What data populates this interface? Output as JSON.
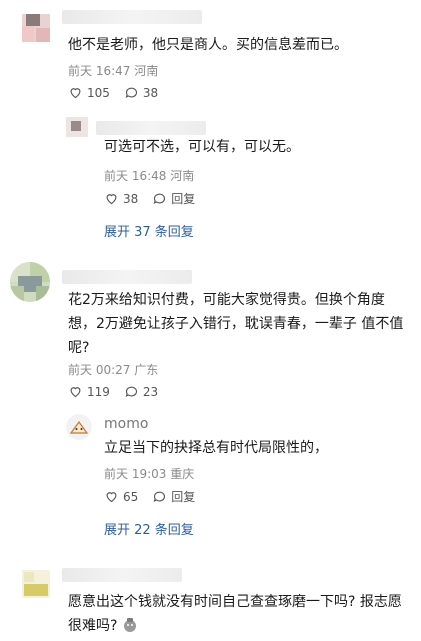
{
  "comments": [
    {
      "text": "他不是老师，他只是商人。买的信息差而已。",
      "time": "前天 16:47",
      "location": "河南",
      "likes": "105",
      "replies_count": "38",
      "reply": {
        "text": "可选可不选，可以有，可以无。",
        "time": "前天 16:48",
        "location": "河南",
        "likes": "38",
        "reply_label": "回复"
      },
      "expand_label": "展开 37 条回复"
    },
    {
      "text_lines": [
        "花2万来给知识付费，可能大家觉得贵。但换个角度",
        "想，2万避免让孩子入错行，耽误青春，一辈子 值不值",
        "呢?"
      ],
      "time": "前天 00:27",
      "location": "广东",
      "likes": "119",
      "replies_count": "23",
      "reply": {
        "username": "momo",
        "text": "立足当下的抉择总有时代局限性的，",
        "time": "前天 19:03",
        "location": "重庆",
        "likes": "65",
        "reply_label": "回复"
      },
      "expand_label": "展开 22 条回复"
    },
    {
      "text_lines": [
        "愿意出这个钱就没有时间自己查查琢磨一下吗? 报志愿",
        "很难吗?"
      ]
    }
  ],
  "colors": {
    "link": "#2f5d9e",
    "meta": "#8a8a8a",
    "text": "#1a1a1a"
  }
}
